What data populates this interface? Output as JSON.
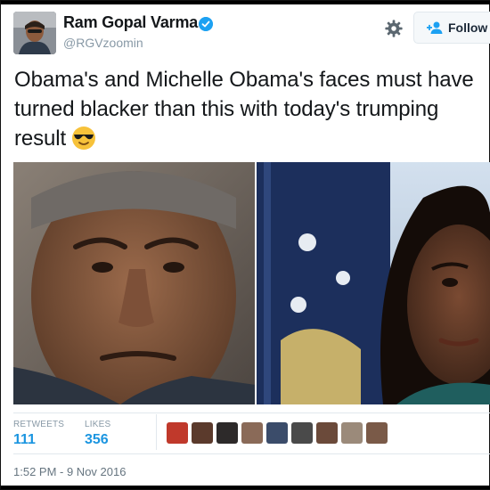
{
  "author": {
    "name": "Ram Gopal Varma",
    "handle": "@RGVzoomin"
  },
  "follow": {
    "label": "Follow"
  },
  "tweet": {
    "text": "Obama's and Michelle Obama's faces must have turned blacker than this with today's trumping result",
    "emoji": "sunglasses-face-icon"
  },
  "stats": {
    "retweets_label": "RETWEETS",
    "retweets_value": "111",
    "likes_label": "LIKES",
    "likes_value": "356"
  },
  "timestamp": "1:52 PM - 9 Nov 2016",
  "colors": {
    "link_blue": "#1b95e0",
    "verified_blue": "#1da1f2",
    "muted": "#8899a6"
  }
}
